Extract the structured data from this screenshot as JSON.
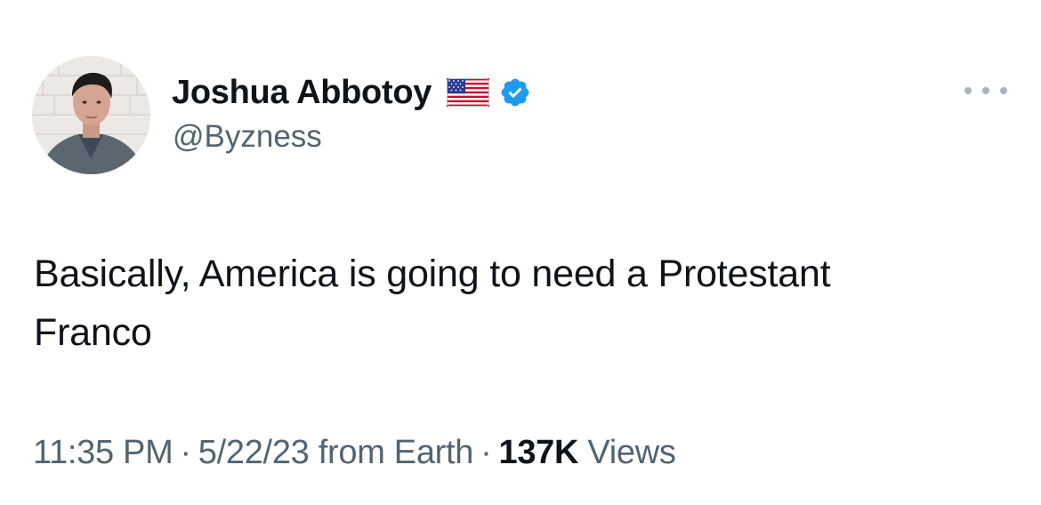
{
  "tweet": {
    "author": {
      "display_name": "Joshua Abbotoy",
      "emoji_icon": "us-flag-icon",
      "badge_icon": "verified-badge-icon",
      "badge_color": "#1d9bf0",
      "handle": "@Byzness"
    },
    "more_icon": "more-options-icon",
    "text_line1": "Basically, America is going to need a Protestant",
    "text_line2": "Franco",
    "meta": {
      "time": "11:35 PM",
      "separator": "·",
      "date": "5/22/23",
      "source": "from Earth",
      "views_count": "137K",
      "views_label": "Views"
    }
  }
}
